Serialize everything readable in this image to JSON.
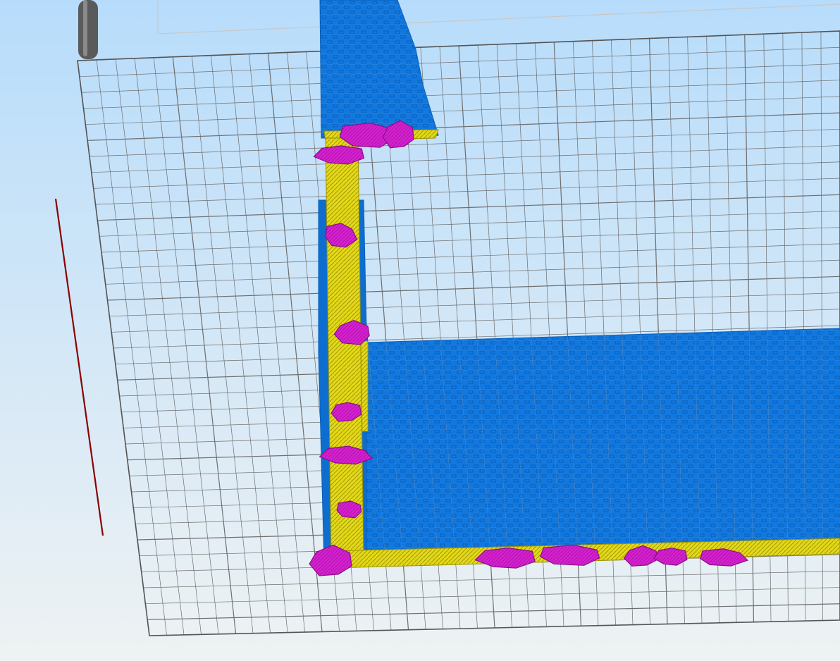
{
  "viewport": {
    "name": "3d-slicer-layer-preview",
    "background_top": "#b7dcfb",
    "background_bottom": "#eef2f3"
  },
  "build_plate": {
    "grid_color": "#6f6f6f",
    "border_color": "#555555",
    "backface_color": "#d0d0d0"
  },
  "axis": {
    "name": "x-axis-indicator",
    "color": "#8b0000"
  },
  "toolpath_colors": {
    "infill": "#1178e0",
    "infill_dark": "#0a5fb8",
    "perimeter": "#e3d81a",
    "perimeter_dark": "#9c9400",
    "support": "#d620d0",
    "support_dark": "#8a0f88"
  },
  "extruder_nozzle": {
    "name": "nozzle-rod",
    "color": "#555555"
  }
}
